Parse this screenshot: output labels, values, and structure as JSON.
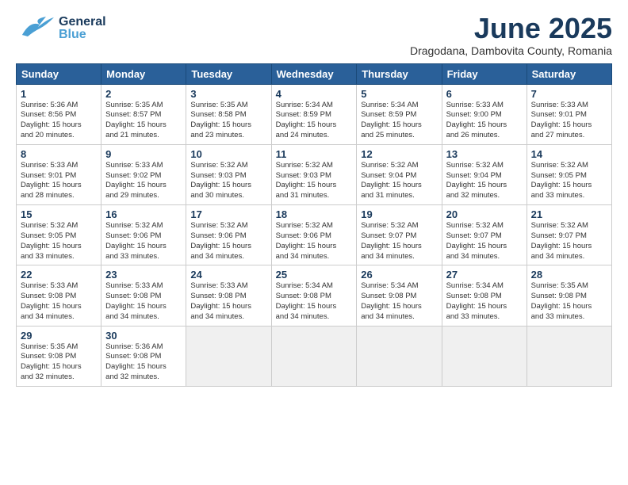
{
  "header": {
    "logo_general": "General",
    "logo_blue": "Blue",
    "title": "June 2025",
    "subtitle": "Dragodana, Dambovita County, Romania"
  },
  "weekdays": [
    "Sunday",
    "Monday",
    "Tuesday",
    "Wednesday",
    "Thursday",
    "Friday",
    "Saturday"
  ],
  "weeks": [
    [
      {
        "day": "1",
        "info": "Sunrise: 5:36 AM\nSunset: 8:56 PM\nDaylight: 15 hours\nand 20 minutes."
      },
      {
        "day": "2",
        "info": "Sunrise: 5:35 AM\nSunset: 8:57 PM\nDaylight: 15 hours\nand 21 minutes."
      },
      {
        "day": "3",
        "info": "Sunrise: 5:35 AM\nSunset: 8:58 PM\nDaylight: 15 hours\nand 23 minutes."
      },
      {
        "day": "4",
        "info": "Sunrise: 5:34 AM\nSunset: 8:59 PM\nDaylight: 15 hours\nand 24 minutes."
      },
      {
        "day": "5",
        "info": "Sunrise: 5:34 AM\nSunset: 8:59 PM\nDaylight: 15 hours\nand 25 minutes."
      },
      {
        "day": "6",
        "info": "Sunrise: 5:33 AM\nSunset: 9:00 PM\nDaylight: 15 hours\nand 26 minutes."
      },
      {
        "day": "7",
        "info": "Sunrise: 5:33 AM\nSunset: 9:01 PM\nDaylight: 15 hours\nand 27 minutes."
      }
    ],
    [
      {
        "day": "8",
        "info": "Sunrise: 5:33 AM\nSunset: 9:01 PM\nDaylight: 15 hours\nand 28 minutes."
      },
      {
        "day": "9",
        "info": "Sunrise: 5:33 AM\nSunset: 9:02 PM\nDaylight: 15 hours\nand 29 minutes."
      },
      {
        "day": "10",
        "info": "Sunrise: 5:32 AM\nSunset: 9:03 PM\nDaylight: 15 hours\nand 30 minutes."
      },
      {
        "day": "11",
        "info": "Sunrise: 5:32 AM\nSunset: 9:03 PM\nDaylight: 15 hours\nand 31 minutes."
      },
      {
        "day": "12",
        "info": "Sunrise: 5:32 AM\nSunset: 9:04 PM\nDaylight: 15 hours\nand 31 minutes."
      },
      {
        "day": "13",
        "info": "Sunrise: 5:32 AM\nSunset: 9:04 PM\nDaylight: 15 hours\nand 32 minutes."
      },
      {
        "day": "14",
        "info": "Sunrise: 5:32 AM\nSunset: 9:05 PM\nDaylight: 15 hours\nand 33 minutes."
      }
    ],
    [
      {
        "day": "15",
        "info": "Sunrise: 5:32 AM\nSunset: 9:05 PM\nDaylight: 15 hours\nand 33 minutes."
      },
      {
        "day": "16",
        "info": "Sunrise: 5:32 AM\nSunset: 9:06 PM\nDaylight: 15 hours\nand 33 minutes."
      },
      {
        "day": "17",
        "info": "Sunrise: 5:32 AM\nSunset: 9:06 PM\nDaylight: 15 hours\nand 34 minutes."
      },
      {
        "day": "18",
        "info": "Sunrise: 5:32 AM\nSunset: 9:06 PM\nDaylight: 15 hours\nand 34 minutes."
      },
      {
        "day": "19",
        "info": "Sunrise: 5:32 AM\nSunset: 9:07 PM\nDaylight: 15 hours\nand 34 minutes."
      },
      {
        "day": "20",
        "info": "Sunrise: 5:32 AM\nSunset: 9:07 PM\nDaylight: 15 hours\nand 34 minutes."
      },
      {
        "day": "21",
        "info": "Sunrise: 5:32 AM\nSunset: 9:07 PM\nDaylight: 15 hours\nand 34 minutes."
      }
    ],
    [
      {
        "day": "22",
        "info": "Sunrise: 5:33 AM\nSunset: 9:08 PM\nDaylight: 15 hours\nand 34 minutes."
      },
      {
        "day": "23",
        "info": "Sunrise: 5:33 AM\nSunset: 9:08 PM\nDaylight: 15 hours\nand 34 minutes."
      },
      {
        "day": "24",
        "info": "Sunrise: 5:33 AM\nSunset: 9:08 PM\nDaylight: 15 hours\nand 34 minutes."
      },
      {
        "day": "25",
        "info": "Sunrise: 5:34 AM\nSunset: 9:08 PM\nDaylight: 15 hours\nand 34 minutes."
      },
      {
        "day": "26",
        "info": "Sunrise: 5:34 AM\nSunset: 9:08 PM\nDaylight: 15 hours\nand 34 minutes."
      },
      {
        "day": "27",
        "info": "Sunrise: 5:34 AM\nSunset: 9:08 PM\nDaylight: 15 hours\nand 33 minutes."
      },
      {
        "day": "28",
        "info": "Sunrise: 5:35 AM\nSunset: 9:08 PM\nDaylight: 15 hours\nand 33 minutes."
      }
    ],
    [
      {
        "day": "29",
        "info": "Sunrise: 5:35 AM\nSunset: 9:08 PM\nDaylight: 15 hours\nand 32 minutes."
      },
      {
        "day": "30",
        "info": "Sunrise: 5:36 AM\nSunset: 9:08 PM\nDaylight: 15 hours\nand 32 minutes."
      },
      null,
      null,
      null,
      null,
      null
    ]
  ]
}
